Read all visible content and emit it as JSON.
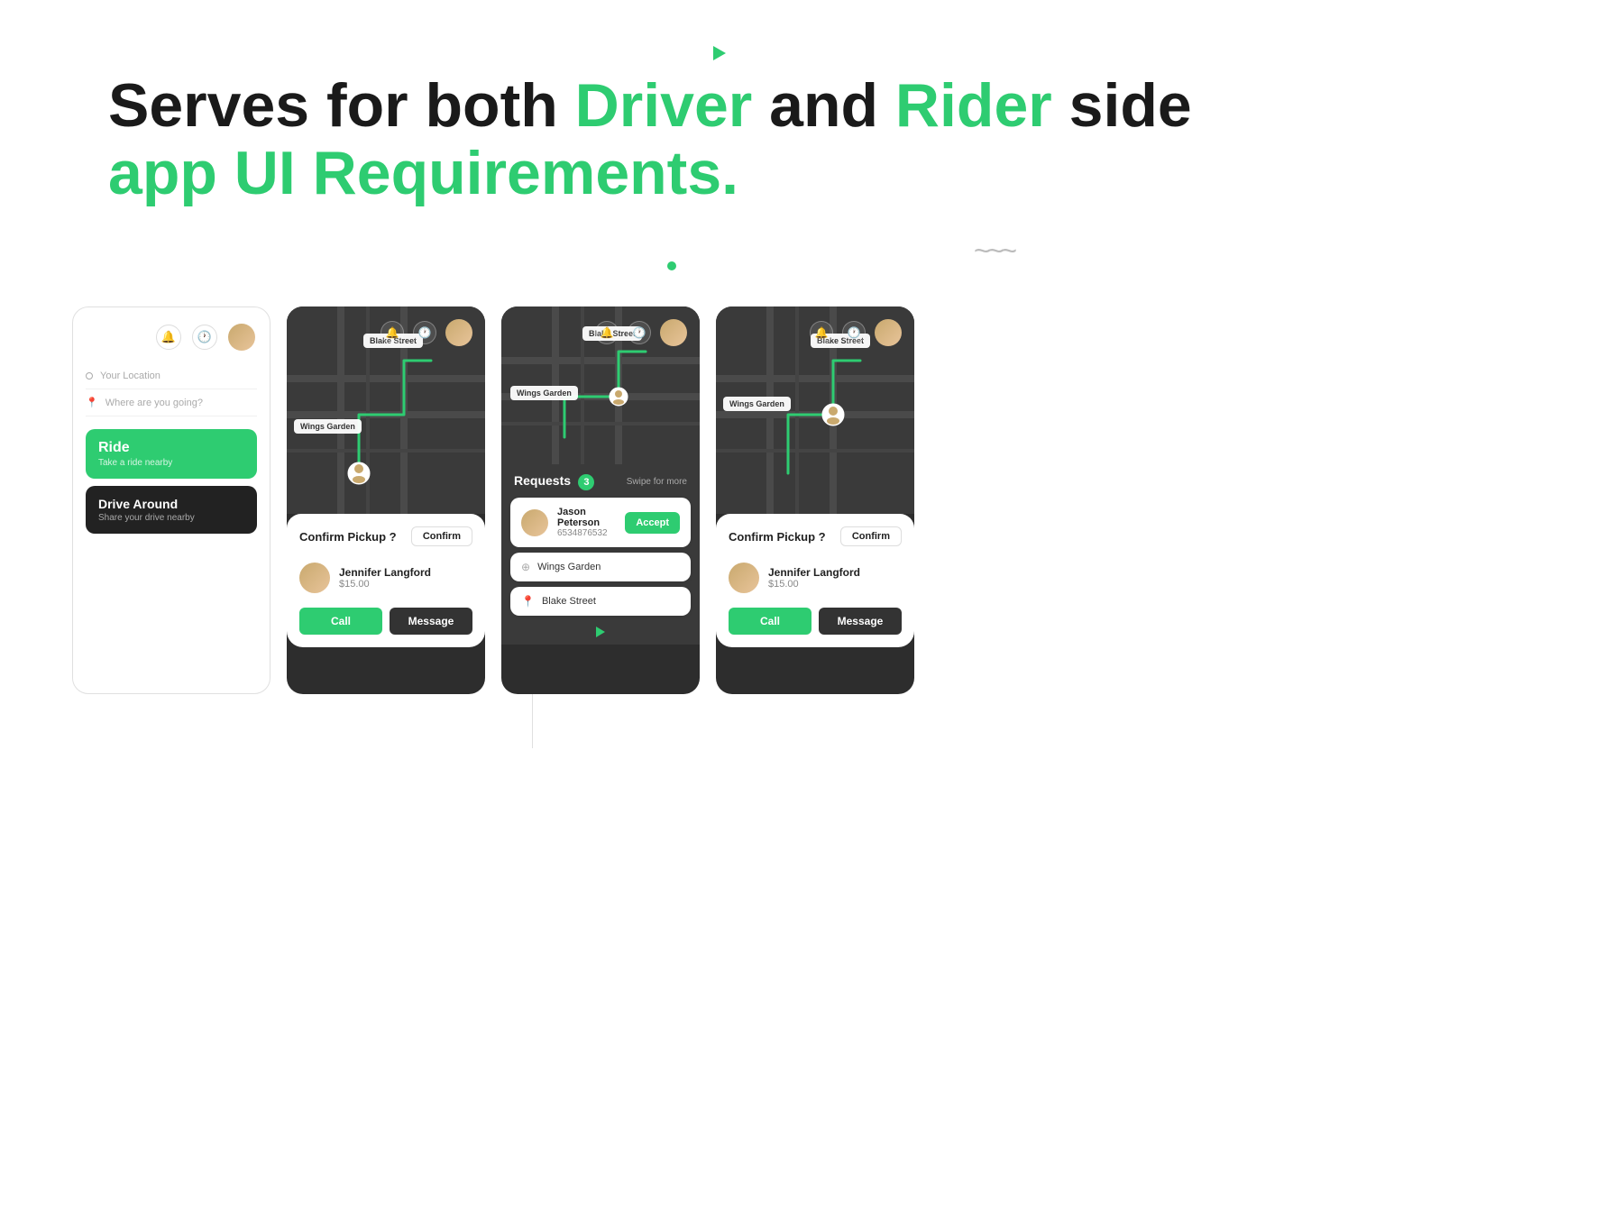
{
  "header": {
    "line1_prefix": "Serves for both ",
    "driver_word": "Driver",
    "line1_middle": " and ",
    "rider_word": "Rider",
    "line1_suffix": " side",
    "line2": "app UI Requirements."
  },
  "screen1": {
    "your_location": "Your Location",
    "where_going": "Where are you going?",
    "ride_title": "Ride",
    "ride_sub": "Take a ride nearby",
    "drive_title": "Drive Around",
    "drive_sub": "Share your drive nearby"
  },
  "screen2": {
    "map_label1": "Blake Street",
    "map_label2": "Wings Garden",
    "confirm_text": "Confirm Pickup ?",
    "confirm_btn": "Confirm",
    "rider_name": "Jennifer Langford",
    "rider_price": "$15.00",
    "call_btn": "Call",
    "message_btn": "Message"
  },
  "screen3": {
    "requests_label": "Requests",
    "requests_count": "3",
    "swipe_text": "Swipe for more",
    "map_label1": "Blake Street",
    "map_label2": "Wings Garden",
    "requester_name": "Jason Peterson",
    "requester_phone": "6534876532",
    "accept_btn": "Accept",
    "location1": "Wings Garden",
    "location2": "Blake Street"
  },
  "screen4": {
    "map_label1": "Blake Street",
    "map_label2": "Wings Garden",
    "confirm_text": "Confirm Pickup ?",
    "confirm_btn": "Confirm",
    "rider_name": "Jennifer Langford",
    "rider_price": "$15.00",
    "call_btn": "Call",
    "message_btn": "Message"
  },
  "colors": {
    "green": "#2ecc71",
    "dark_bg": "#2d2d2d",
    "white": "#ffffff"
  }
}
